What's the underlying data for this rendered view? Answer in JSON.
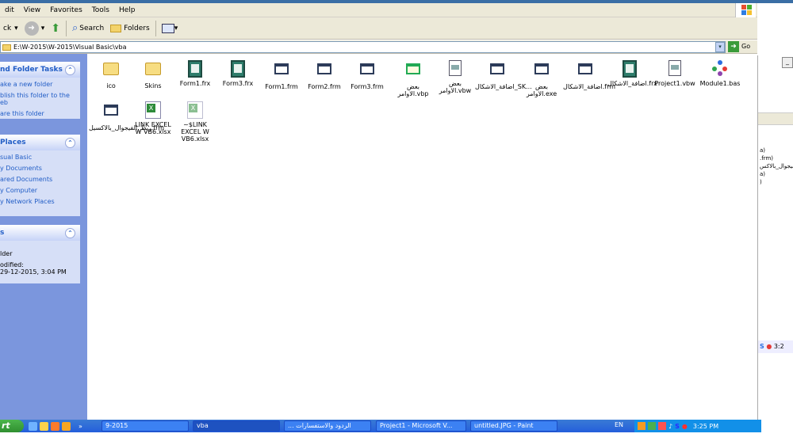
{
  "menu": [
    "dit",
    "View",
    "Favorites",
    "Tools",
    "Help"
  ],
  "toolbar": {
    "back": "ck",
    "search": "Search",
    "folders": "Folders"
  },
  "address": {
    "path": "E:\\W-2015\\W-2015\\Visual Basic\\vba",
    "go": "Go"
  },
  "tasks": {
    "title": "nd Folder Tasks",
    "items": [
      "ake a new folder",
      "blish this folder to the",
      "eb",
      "are this folder"
    ]
  },
  "places": {
    "title": "Places",
    "items": [
      "sual Basic",
      "y Documents",
      "ared Documents",
      "y Computer",
      "y Network Places"
    ]
  },
  "details": {
    "title": "s",
    "items": [
      "lder",
      "odified:",
      "29-12-2015, 3:04 PM"
    ]
  },
  "files": [
    {
      "name": "ico",
      "type": "folder"
    },
    {
      "name": "Skins",
      "type": "folder"
    },
    {
      "name": "Form1.frx",
      "type": "frx"
    },
    {
      "name": "Form3.frx",
      "type": "frx"
    },
    {
      "name": "Form1.frm",
      "type": "frm"
    },
    {
      "name": "Form2.frm",
      "type": "frm"
    },
    {
      "name": "Form3.frm",
      "type": "frm"
    },
    {
      "name": "بعض الاوامر.vbp",
      "type": "vbp"
    },
    {
      "name": "بعض الاوامر.vbw",
      "type": "vbw"
    },
    {
      "name": "اضافة_الاشكال_SK...",
      "type": "frm"
    },
    {
      "name": "بعض الاوامر.exe",
      "type": "frm"
    },
    {
      "name": "اضافة_الاشكال.frm",
      "type": "frm"
    },
    {
      "name": "اضافة_الاشكال.frx",
      "type": "frx"
    },
    {
      "name": "Project1.vbw",
      "type": "vbw"
    },
    {
      "name": "Module1.bas",
      "type": "mod"
    },
    {
      "name": "ربط_الفيجوال_بالاكسيل.frm",
      "type": "frm"
    },
    {
      "name": "LINK EXCEL W VB6.xlsx",
      "type": "xls"
    },
    {
      "name": "~$LINK EXCEL W VB6.xlsx",
      "type": "xls"
    }
  ],
  "rightwin": {
    "lines": [
      "a)",
      ".frm)",
      "ربط_الفيجوال_بالاكس",
      "a)",
      ")"
    ],
    "clock": "3:2"
  },
  "taskbar": {
    "start": "rt",
    "buttons": [
      "9-2015",
      "vba",
      "... الردود والاستفسارات",
      "Project1 - Microsoft V...",
      "untitled.JPG - Paint"
    ],
    "lang": "EN",
    "time": "3:25 PM"
  }
}
